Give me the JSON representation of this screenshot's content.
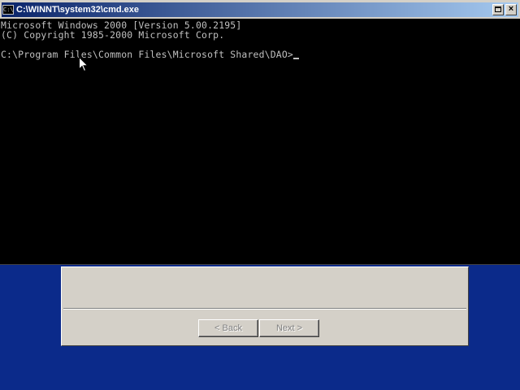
{
  "window": {
    "title": "C:\\WINNT\\system32\\cmd.exe",
    "system_icon_text": "C:\\"
  },
  "console": {
    "lines": [
      "Microsoft Windows 2000 [Version 5.00.2195]",
      "(C) Copyright 1985-2000 Microsoft Corp."
    ],
    "prompt": "C:\\Program Files\\Common Files\\Microsoft Shared\\DAO>"
  },
  "wizard": {
    "back_label": "< Back",
    "next_label": "Next >"
  },
  "icons": {
    "system": "console-icon",
    "maximize": "maximize-icon",
    "close": "close-icon",
    "pointer": "mouse-pointer-icon"
  },
  "colors": {
    "titlebar_start": "#0a246a",
    "titlebar_end": "#a6caf0",
    "console_bg": "#000000",
    "console_fg": "#c0c0c0",
    "desktop": "#0b2a8a",
    "dialog_face": "#d4d0c8"
  }
}
